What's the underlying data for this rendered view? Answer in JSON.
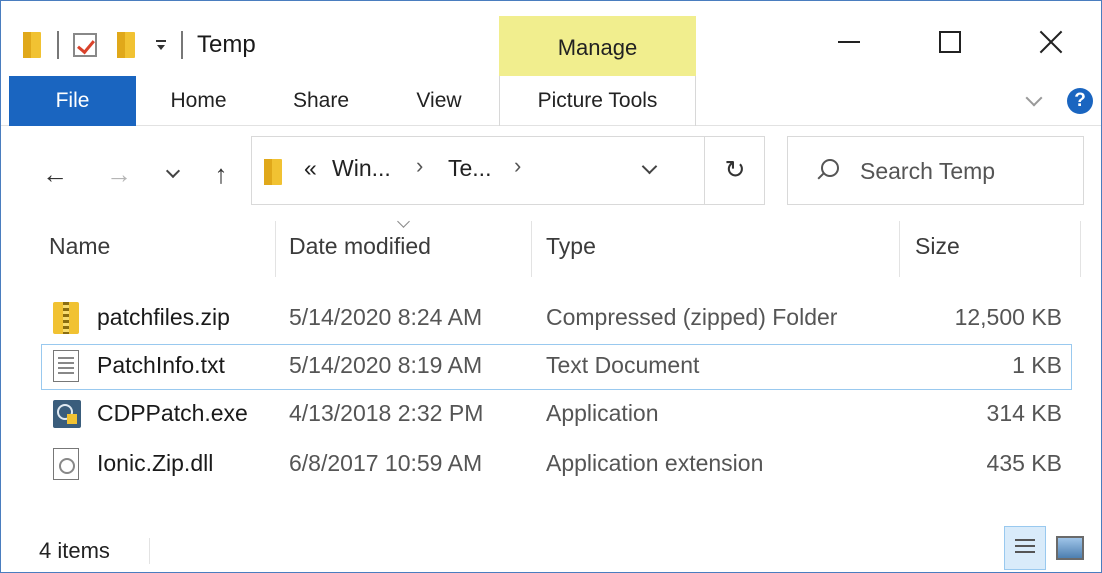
{
  "window": {
    "title": "Temp",
    "contextual_tab": "Manage"
  },
  "ribbon": {
    "tabs": [
      "File",
      "Home",
      "Share",
      "View",
      "Picture Tools"
    ],
    "help_label": "?"
  },
  "navigation": {
    "back": "←",
    "forward": "→",
    "up": "↑",
    "refresh": "↻",
    "breadcrumb_prefix": "«",
    "breadcrumb": [
      "Win...",
      "Te..."
    ],
    "breadcrumb_sep": "›"
  },
  "search": {
    "placeholder": "Search Temp",
    "value": ""
  },
  "columns": [
    "Name",
    "Date modified",
    "Type",
    "Size"
  ],
  "files": [
    {
      "name": "patchfiles.zip",
      "date": "5/14/2020 8:24 AM",
      "type": "Compressed (zipped) Folder",
      "size": "12,500 KB",
      "icon": "zip-folder-icon",
      "selected": false
    },
    {
      "name": "PatchInfo.txt",
      "date": "5/14/2020 8:19 AM",
      "type": "Text Document",
      "size": "1 KB",
      "icon": "text-document-icon",
      "selected": true
    },
    {
      "name": "CDPPatch.exe",
      "date": "4/13/2018 2:32 PM",
      "type": "Application",
      "size": "314 KB",
      "icon": "application-icon",
      "selected": false
    },
    {
      "name": "Ionic.Zip.dll",
      "date": "6/8/2017 10:59 AM",
      "type": "Application extension",
      "size": "435 KB",
      "icon": "dll-icon",
      "selected": false
    }
  ],
  "status": {
    "item_count": "4 items"
  },
  "colors": {
    "file_tab": "#1a65c0",
    "manage_tab": "#f1ee8e",
    "selection_border": "#99c9ef"
  }
}
